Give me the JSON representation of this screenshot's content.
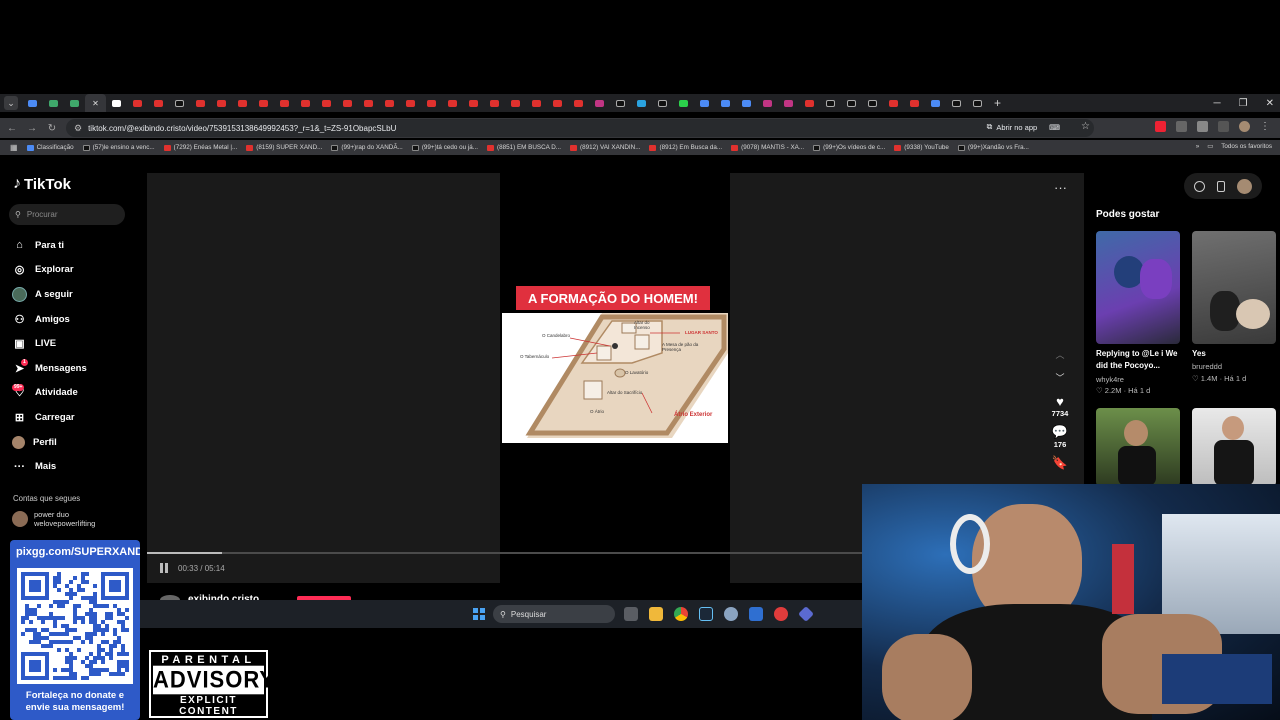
{
  "browser": {
    "url": "tiktok.com/@exibindo.cristo/video/7539153138649992453?_r=1&_t=ZS-91ObapcSLbU",
    "open_app_label": "Abrir no app",
    "bookmarks": [
      {
        "label": "Classificação",
        "icon": "google"
      },
      {
        "label": "(57)le ensino a venc...",
        "icon": "tiktok"
      },
      {
        "label": "(7292) Enéas Metal |...",
        "icon": "youtube"
      },
      {
        "label": "(8159) SUPER XAND...",
        "icon": "youtube"
      },
      {
        "label": "(99+)rap do XANDÃ...",
        "icon": "tiktok"
      },
      {
        "label": "(99+)tá cedo ou já...",
        "icon": "tiktok"
      },
      {
        "label": "(8851) EM BUSCA D...",
        "icon": "youtube"
      },
      {
        "label": "(8912) VAI XANDIN...",
        "icon": "youtube"
      },
      {
        "label": "(8912) Em Busca da...",
        "icon": "youtube"
      },
      {
        "label": "(9078) MANTIS - XA...",
        "icon": "youtube"
      },
      {
        "label": "(99+)Os vídeos de c...",
        "icon": "tiktok"
      },
      {
        "label": "(9338) YouTube",
        "icon": "youtube"
      },
      {
        "label": "(99+)Xandão vs Fra...",
        "icon": "tiktok"
      }
    ],
    "all_bookmarks_label": "Todos os favoritos",
    "colors": {
      "tab_bar": "#202124",
      "toolbar": "#35363a",
      "youtube_red": "#e0312e"
    }
  },
  "tiktok": {
    "logo_text": "TikTok",
    "search_placeholder": "Procurar",
    "menu": [
      {
        "label": "Para ti",
        "icon": "home-icon"
      },
      {
        "label": "Explorar",
        "icon": "compass-icon"
      },
      {
        "label": "A seguir",
        "icon": "avatar"
      },
      {
        "label": "Amigos",
        "icon": "friends-icon"
      },
      {
        "label": "LIVE",
        "icon": "live-icon"
      },
      {
        "label": "Mensagens",
        "icon": "send-icon",
        "badge": "1"
      },
      {
        "label": "Atividade",
        "icon": "bell-icon",
        "badge": "99+"
      },
      {
        "label": "Carregar",
        "icon": "plus-square-icon"
      },
      {
        "label": "Perfil",
        "icon": "avatar"
      },
      {
        "label": "Mais",
        "icon": "more-icon"
      }
    ],
    "following_title": "Contas que segues",
    "following": [
      {
        "name": "power duo",
        "handle": "welovepowerlifting"
      }
    ],
    "video": {
      "title_banner": "A FORMAÇÃO DO HOMEM!",
      "diagram_labels": [
        "Altar do Incenso",
        "LUGAR SANTO",
        "O Candelabro",
        "A Mesa de pão da Presença",
        "O Tabernáculo",
        "O Lavatório",
        "Altar do Sacrifício",
        "Átrio Exterior",
        "O Átrio"
      ],
      "time": "00:33 / 05:14",
      "progress": 0.105,
      "author": "exibindo.cristo",
      "likes": "7734",
      "comments": "176"
    },
    "suggested_title": "Podes gostar",
    "suggested": [
      {
        "caption": "Replying to @Le i We did the Pocoyo...",
        "author": "whyk4re",
        "stats": "♡ 2.2M · Há 1 d"
      },
      {
        "caption": "Yes",
        "author": "brureddd",
        "stats": "♡ 1.4M · Há 1 d"
      }
    ]
  },
  "taskbar": {
    "search_placeholder": "Pesquisar"
  },
  "stream_overlay": {
    "donate_url": "pixgg.com/SUPERXANDÃO",
    "donate_message": "Fortaleça no donate e envie sua mensagem!",
    "parental_top": "PARENTAL",
    "parental_mid": "ADVISORY",
    "parental_bottom": "EXPLICIT CONTENT"
  }
}
